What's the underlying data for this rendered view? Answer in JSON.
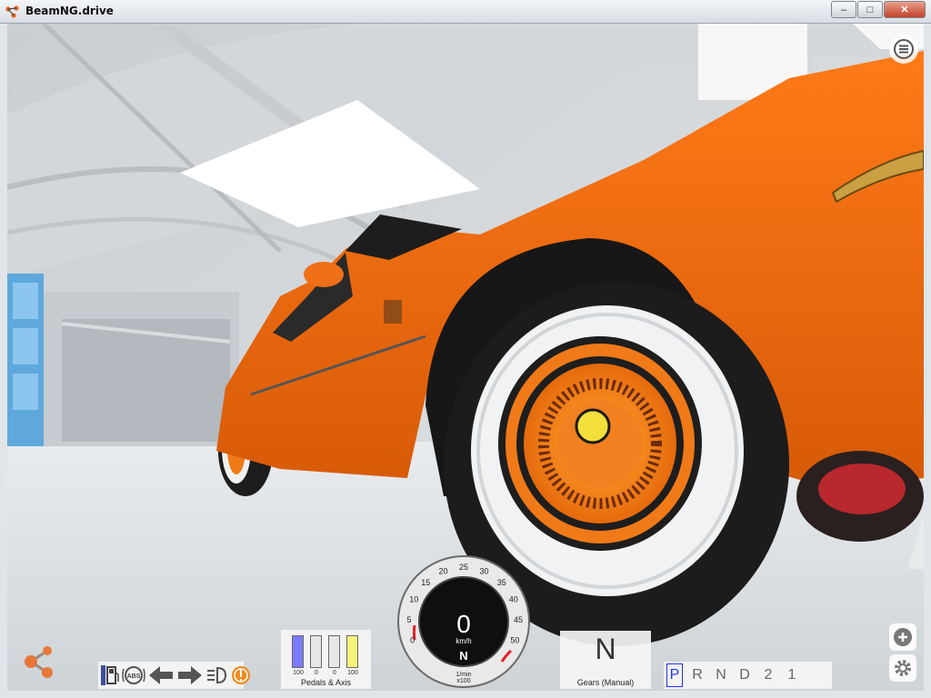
{
  "window": {
    "title": "BeamNG.drive",
    "controls": {
      "minimize": "–",
      "maximize": "□",
      "close": "✕"
    }
  },
  "hud": {
    "menu_icon": "hamburger-menu-icon",
    "pedals": {
      "label": "Pedals & Axis",
      "bars": [
        {
          "value": "100",
          "fraction": 1.0,
          "color": "#7b7bff"
        },
        {
          "value": "0",
          "fraction": 0.0,
          "color": "#e0e0e0"
        },
        {
          "value": "0",
          "fraction": 0.0,
          "color": "#e0e0e0"
        },
        {
          "value": "100",
          "fraction": 1.0,
          "color": "#f4f47a"
        }
      ]
    },
    "indicators": [
      "fuel-icon",
      "abs-icon",
      "left-turn-signal-icon",
      "right-turn-signal-icon",
      "headlight-icon",
      "brake-warning-icon"
    ],
    "abs_text": "ABS",
    "tachometer": {
      "speed": "0",
      "unit": "km/h",
      "gear": "N",
      "rpm_unit": "1/min",
      "rpm_multiplier": "x100",
      "ticks": [
        "0",
        "5",
        "10",
        "15",
        "20",
        "25",
        "30",
        "35",
        "40",
        "45",
        "50"
      ]
    },
    "gears": {
      "current": "N",
      "label": "Gears (Manual)"
    },
    "shifter": {
      "positions": [
        "P",
        "R",
        "N",
        "D",
        "2",
        "1"
      ],
      "active": "P"
    },
    "camera_buttons": [
      "zoom-in-icon",
      "settings-icon"
    ]
  },
  "colors": {
    "car_body": "#f06a10",
    "hub": "#ff8c1a",
    "whitewall": "#f2f3f4",
    "hangar": "#dfe3e6",
    "redline": "#e0202a"
  }
}
